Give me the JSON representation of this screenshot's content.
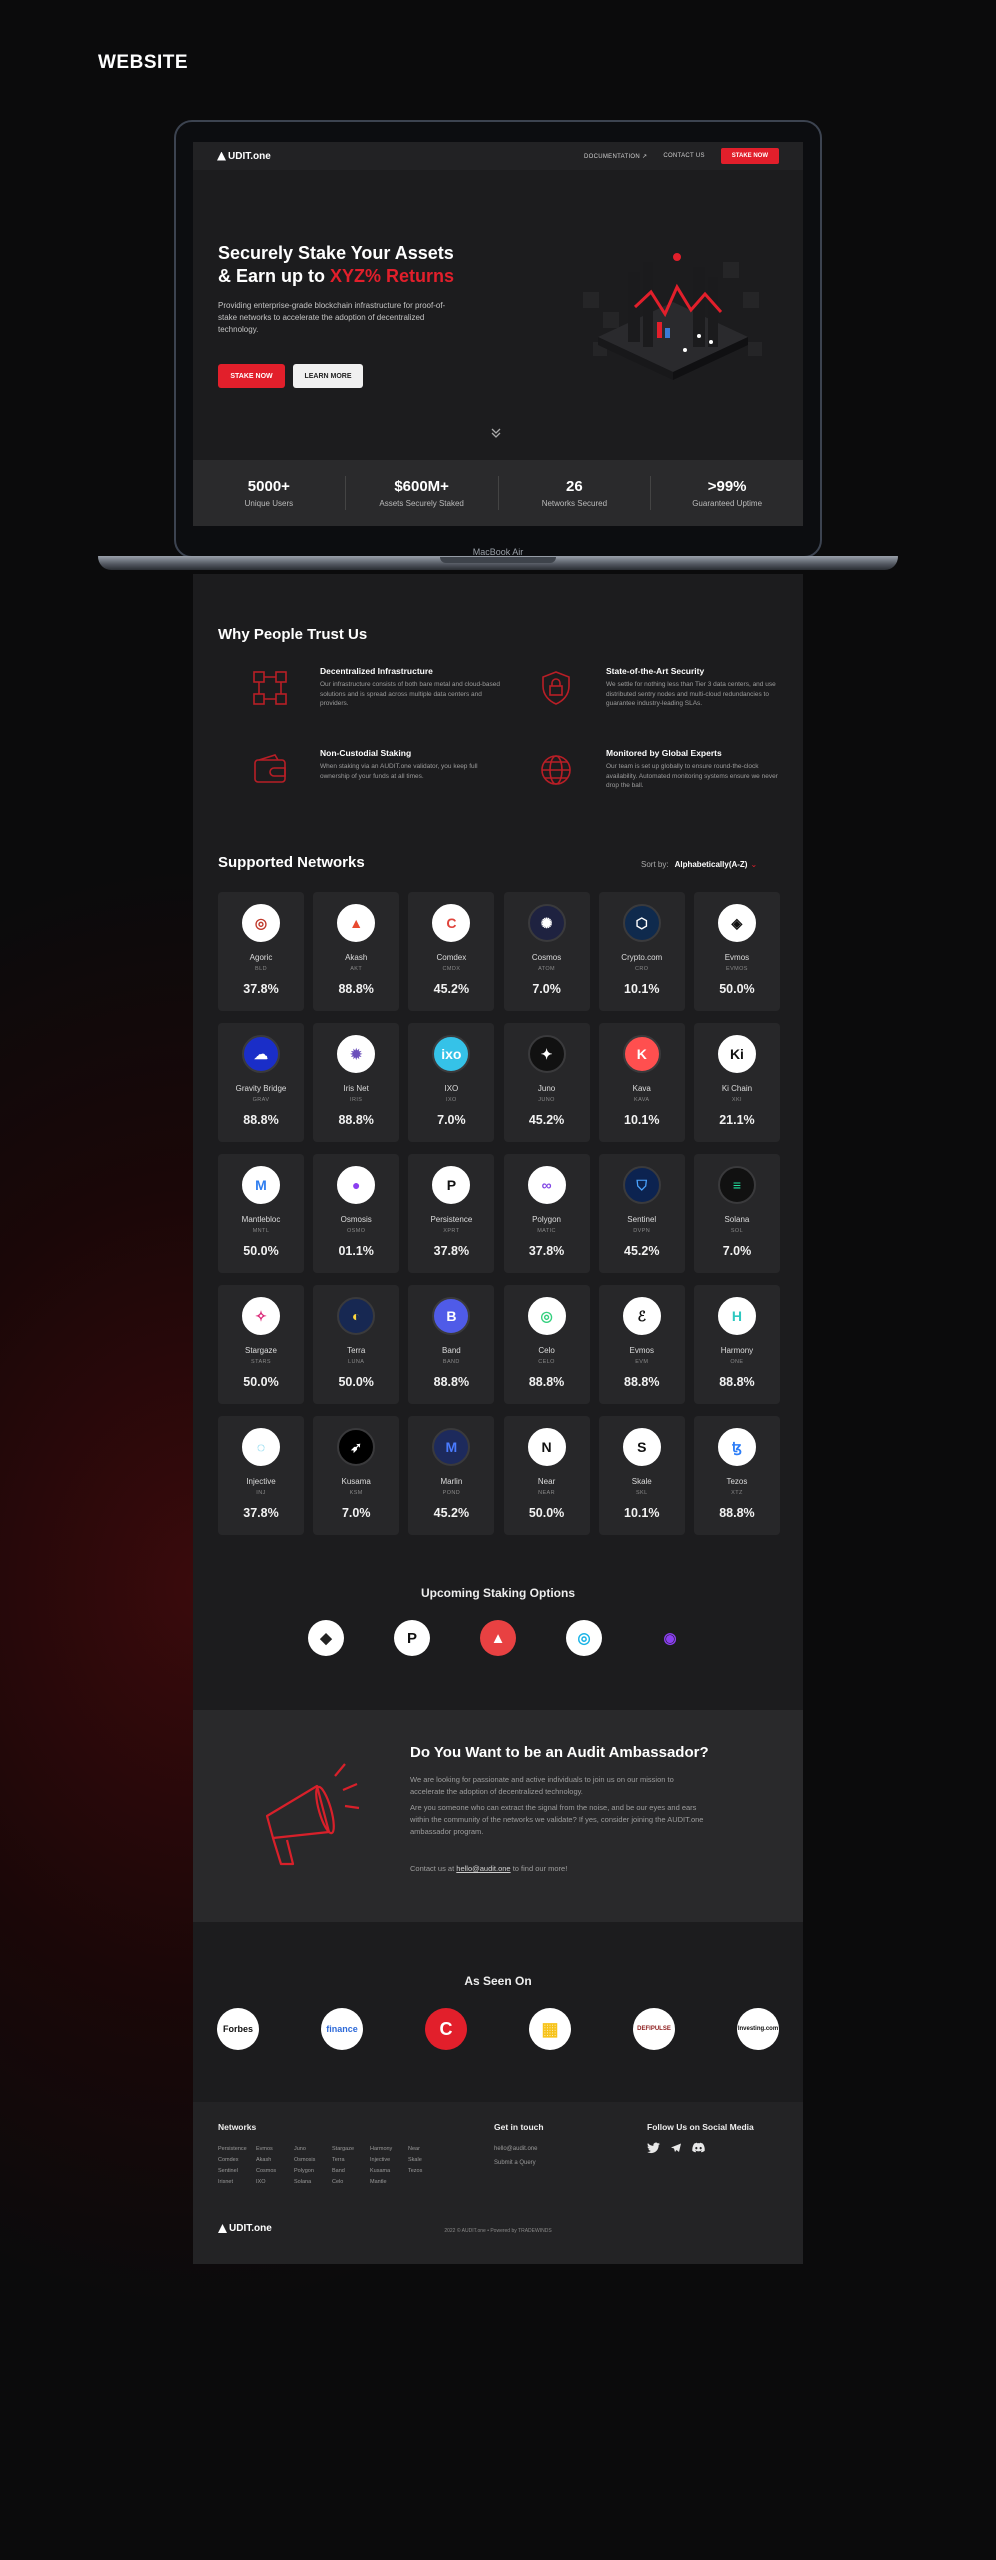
{
  "page_label": "WEBSITE",
  "laptop_brand": "MacBook Air",
  "nav": {
    "logo": "UDIT.one",
    "links": [
      "DOCUMENTATION ↗",
      "CONTACT US"
    ],
    "cta": "STAKE NOW"
  },
  "hero": {
    "title_line1": "Securely Stake Your Assets",
    "title_line2_prefix": "& Earn up to ",
    "title_line2_accent": "XYZ% Returns",
    "subtitle": "Providing enterprise-grade blockchain infrastructure for proof-of-stake networks to accelerate the adoption of decentralized technology.",
    "primary_cta": "STAKE NOW",
    "secondary_cta": "LEARN MORE"
  },
  "stats": [
    {
      "value": "5000+",
      "label": "Unique Users"
    },
    {
      "value": "$600M+",
      "label": "Assets Securely Staked"
    },
    {
      "value": "26",
      "label": "Networks Secured"
    },
    {
      "value": ">99%",
      "label": "Guaranteed Uptime"
    }
  ],
  "trust": {
    "title": "Why People Trust Us",
    "features": [
      {
        "title": "Decentralized Infrastructure",
        "desc": "Our infrastructure consists of both bare metal and cloud-based solutions and is spread across multiple data centers and providers.",
        "icon": "network-icon"
      },
      {
        "title": "State-of-the-Art Security",
        "desc": "We settle for nothing less than Tier 3 data centers, and use distributed sentry nodes and multi-cloud redundancies to guarantee industry-leading SLAs.",
        "icon": "shield-lock-icon"
      },
      {
        "title": "Non-Custodial Staking",
        "desc": "When staking via an AUDIT.one validator, you keep full ownership of your funds at all times.",
        "icon": "wallet-icon"
      },
      {
        "title": "Monitored by Global Experts",
        "desc": "Our team is set up globally to ensure round-the-clock availability. Automated monitoring systems ensure we never drop the ball.",
        "icon": "globe-icon"
      }
    ]
  },
  "networks": {
    "title": "Supported Networks",
    "sort_label": "Sort by:",
    "sort_value": "Alphabetically(A-Z)",
    "items": [
      {
        "name": "Agoric",
        "symbol": "BLD",
        "pct": "37.8%",
        "bg": "#ffffff",
        "fg": "#c0392b",
        "glyph": "◎"
      },
      {
        "name": "Akash",
        "symbol": "AKT",
        "pct": "88.8%",
        "bg": "#ffffff",
        "fg": "#e8492f",
        "glyph": "▲"
      },
      {
        "name": "Comdex",
        "symbol": "CMDX",
        "pct": "45.2%",
        "bg": "#ffffff",
        "fg": "#e0443c",
        "glyph": "C"
      },
      {
        "name": "Cosmos",
        "symbol": "ATOM",
        "pct": "7.0%",
        "bg": "#1e2240",
        "fg": "#ffffff",
        "glyph": "✺"
      },
      {
        "name": "Crypto.com",
        "symbol": "CRO",
        "pct": "10.1%",
        "bg": "#0f2a4d",
        "fg": "#ffffff",
        "glyph": "⬡"
      },
      {
        "name": "Evmos",
        "symbol": "EVMOS",
        "pct": "50.0%",
        "bg": "#ffffff",
        "fg": "#111111",
        "glyph": "◈"
      },
      {
        "name": "Gravity Bridge",
        "symbol": "GRAV",
        "pct": "88.8%",
        "bg": "#1a2ec8",
        "fg": "#ffffff",
        "glyph": "☁"
      },
      {
        "name": "Iris Net",
        "symbol": "IRIS",
        "pct": "88.8%",
        "bg": "#ffffff",
        "fg": "#6b4fbb",
        "glyph": "✹"
      },
      {
        "name": "IXO",
        "symbol": "IXO",
        "pct": "7.0%",
        "bg": "#35c2e8",
        "fg": "#ffffff",
        "glyph": "ixo"
      },
      {
        "name": "Juno",
        "symbol": "JUNO",
        "pct": "45.2%",
        "bg": "#111111",
        "fg": "#ffffff",
        "glyph": "✦"
      },
      {
        "name": "Kava",
        "symbol": "KAVA",
        "pct": "10.1%",
        "bg": "#ff4f4f",
        "fg": "#ffffff",
        "glyph": "K"
      },
      {
        "name": "Ki Chain",
        "symbol": "XKI",
        "pct": "21.1%",
        "bg": "#ffffff",
        "fg": "#111111",
        "glyph": "Ki"
      },
      {
        "name": "Mantlebloc",
        "symbol": "MNTL",
        "pct": "50.0%",
        "bg": "#ffffff",
        "fg": "#2f7ef0",
        "glyph": "M"
      },
      {
        "name": "Osmosis",
        "symbol": "OSMO",
        "pct": "01.1%",
        "bg": "#ffffff",
        "fg": "#8b3ff0",
        "glyph": "●"
      },
      {
        "name": "Persistence",
        "symbol": "XPRT",
        "pct": "37.8%",
        "bg": "#ffffff",
        "fg": "#111111",
        "glyph": "P"
      },
      {
        "name": "Polygon",
        "symbol": "MATIC",
        "pct": "37.8%",
        "bg": "#ffffff",
        "fg": "#8247e5",
        "glyph": "∞"
      },
      {
        "name": "Sentinel",
        "symbol": "DVPN",
        "pct": "45.2%",
        "bg": "#0c2350",
        "fg": "#4aa3ff",
        "glyph": "⛉"
      },
      {
        "name": "Solana",
        "symbol": "SOL",
        "pct": "7.0%",
        "bg": "#111111",
        "fg": "#21e3a0",
        "glyph": "≡"
      },
      {
        "name": "Stargaze",
        "symbol": "STARS",
        "pct": "50.0%",
        "bg": "#ffffff",
        "fg": "#db2777",
        "glyph": "✧"
      },
      {
        "name": "Terra",
        "symbol": "LUNA",
        "pct": "50.0%",
        "bg": "#172852",
        "fg": "#ffd83d",
        "glyph": "◐"
      },
      {
        "name": "Band",
        "symbol": "BAND",
        "pct": "88.8%",
        "bg": "#4f5be8",
        "fg": "#ffffff",
        "glyph": "B"
      },
      {
        "name": "Celo",
        "symbol": "CELO",
        "pct": "88.8%",
        "bg": "#ffffff",
        "fg": "#35d07f",
        "glyph": "◎"
      },
      {
        "name": "Evmos",
        "symbol": "EVM",
        "pct": "88.8%",
        "bg": "#ffffff",
        "fg": "#111111",
        "glyph": "ℰ"
      },
      {
        "name": "Harmony",
        "symbol": "ONE",
        "pct": "88.8%",
        "bg": "#ffffff",
        "fg": "#2ec8c0",
        "glyph": "H"
      },
      {
        "name": "Injective",
        "symbol": "INJ",
        "pct": "37.8%",
        "bg": "#ffffff",
        "fg": "#1fb6e0",
        "glyph": "◌"
      },
      {
        "name": "Kusama",
        "symbol": "KSM",
        "pct": "7.0%",
        "bg": "#000000",
        "fg": "#ffffff",
        "glyph": "➶"
      },
      {
        "name": "Marlin",
        "symbol": "POND",
        "pct": "45.2%",
        "bg": "#1d2a5c",
        "fg": "#4a7bff",
        "glyph": "M"
      },
      {
        "name": "Near",
        "symbol": "NEAR",
        "pct": "50.0%",
        "bg": "#ffffff",
        "fg": "#111111",
        "glyph": "N"
      },
      {
        "name": "Skale",
        "symbol": "SKL",
        "pct": "10.1%",
        "bg": "#ffffff",
        "fg": "#111111",
        "glyph": "S"
      },
      {
        "name": "Tezos",
        "symbol": "XTZ",
        "pct": "88.8%",
        "bg": "#ffffff",
        "fg": "#2c7df7",
        "glyph": "ꜩ"
      }
    ]
  },
  "upcoming": {
    "title": "Upcoming Staking Options",
    "coins": [
      {
        "name": "ethereum",
        "bg": "#ffffff",
        "fg": "#222222",
        "glyph": "◆"
      },
      {
        "name": "polkadot",
        "bg": "#ffffff",
        "fg": "#111111",
        "glyph": "P"
      },
      {
        "name": "avalanche",
        "bg": "#e84142",
        "fg": "#ffffff",
        "glyph": "▲"
      },
      {
        "name": "ocean",
        "bg": "#ffffff",
        "fg": "#19b3e6",
        "glyph": "◎"
      },
      {
        "name": "purple-coin",
        "bg": "#1c1c1e",
        "fg": "#8a3ff0",
        "glyph": "◉"
      }
    ]
  },
  "ambassador": {
    "title": "Do You Want to be an Audit Ambassador?",
    "para1": "We are looking for passionate and active individuals to join us on our mission to accelerate the adoption of decentralized technology.",
    "para2": "Are you someone who can extract the signal from the noise, and be our eyes and ears within the community of the networks we validate? If yes, consider joining the AUDIT.one ambassador program.",
    "contact_prefix": "Contact us at ",
    "contact_email": "hello@audit.one",
    "contact_suffix": " to find our more!"
  },
  "seen_on": {
    "title": "As Seen On",
    "logos": [
      {
        "name": "forbes-logo",
        "text": "Forbes",
        "fg": "#111111",
        "bg": "#ffffff"
      },
      {
        "name": "yahoo-finance-logo",
        "text": "finance",
        "fg": "#2e6ad8",
        "bg": "#ffffff"
      },
      {
        "name": "coin-logo",
        "text": "C",
        "fg": "#ffffff",
        "bg": "#e21f2b"
      },
      {
        "name": "yellow-logo",
        "text": "▦",
        "fg": "#f7c31a",
        "bg": "#ffffff"
      },
      {
        "name": "defi-logo",
        "text": "DEFIPULSE",
        "fg": "#8c1a1a",
        "bg": "#ffffff"
      },
      {
        "name": "investing-logo",
        "text": "Investing.com",
        "fg": "#111111",
        "bg": "#ffffff"
      }
    ]
  },
  "footer": {
    "networks_title": "Networks",
    "network_links": [
      "Persistence",
      "Evmos",
      "Juno",
      "Stargaze",
      "Harmony",
      "Near",
      "Comdex",
      "Akash",
      "Osmosis",
      "Terra",
      "Injective",
      "Skale",
      "Sentinel",
      "Cosmos",
      "Polygon",
      "Band",
      "Kusama",
      "Tezos",
      "Irisnet",
      "IXO",
      "Solana",
      "Celo",
      "Mantle",
      ""
    ],
    "contact_title": "Get in touch",
    "contact_links": [
      "hello@audit.one",
      "Submit a Query"
    ],
    "social_title": "Follow Us on Social Media",
    "logo": "UDIT.one",
    "copyright": "2022 © AUDIT.one  •  Powered by TRADEWINDS"
  }
}
